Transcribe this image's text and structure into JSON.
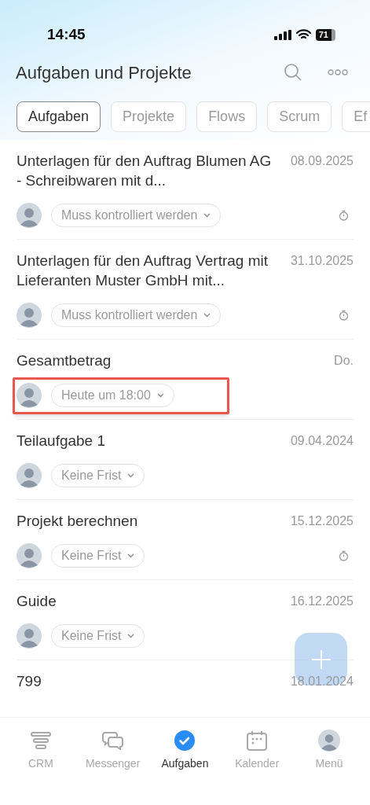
{
  "status_bar": {
    "time": "14:45",
    "battery": "71"
  },
  "header": {
    "title": "Aufgaben und Projekte"
  },
  "tabs": [
    {
      "label": "Aufgaben",
      "selected": true
    },
    {
      "label": "Projekte",
      "selected": false
    },
    {
      "label": "Flows",
      "selected": false
    },
    {
      "label": "Scrum",
      "selected": false
    },
    {
      "label": "Ef",
      "selected": false
    }
  ],
  "tasks": [
    {
      "title": "Unterlagen für den Auftrag Blumen AG - Schreibwaren mit d...",
      "date": "08.09.2025",
      "deadline": "Muss kontrolliert werden",
      "timer": true,
      "highlighted": false
    },
    {
      "title": "Unterlagen für den Auftrag Vertrag mit Lieferanten Muster GmbH mit...",
      "date": "31.10.2025",
      "deadline": "Muss kontrolliert werden",
      "timer": true,
      "highlighted": false
    },
    {
      "title": "Gesamtbetrag",
      "date": "Do.",
      "deadline": "Heute um 18:00",
      "timer": false,
      "highlighted": true
    },
    {
      "title": "Teilaufgabe 1",
      "date": "09.04.2024",
      "deadline": "Keine Frist",
      "timer": false,
      "highlighted": false
    },
    {
      "title": "Projekt berechnen",
      "date": "15.12.2025",
      "deadline": "Keine Frist",
      "timer": true,
      "highlighted": false
    },
    {
      "title": "Guide",
      "date": "16.12.2025",
      "deadline": "Keine Frist",
      "timer": false,
      "highlighted": false
    },
    {
      "title": "799",
      "date": "18.01.2024"
    }
  ],
  "bottom_nav": [
    {
      "kind": "crm",
      "label": "CRM",
      "selected": false
    },
    {
      "kind": "messenger",
      "label": "Messenger",
      "selected": false
    },
    {
      "kind": "tasks",
      "label": "Aufgaben",
      "selected": true
    },
    {
      "kind": "calendar",
      "label": "Kalender",
      "selected": false
    },
    {
      "kind": "avatar",
      "label": "Menü",
      "selected": false
    }
  ]
}
